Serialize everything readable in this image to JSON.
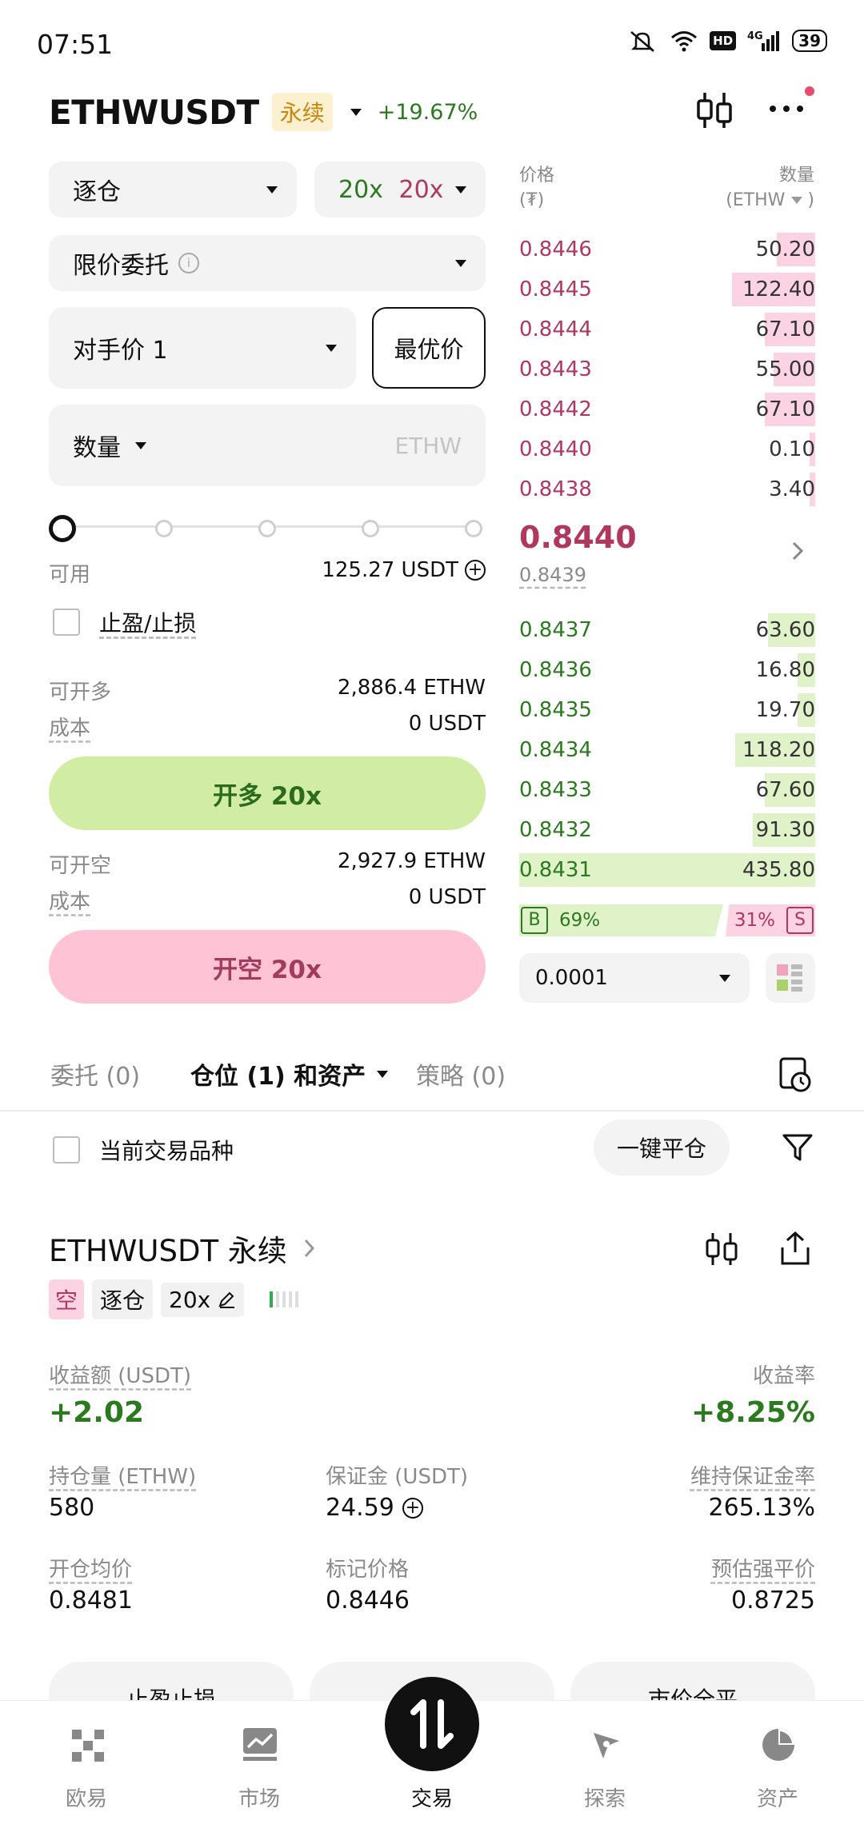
{
  "status_bar": {
    "time": "07:51",
    "battery": "39"
  },
  "header": {
    "symbol": "ETHWUSDT",
    "contract_tag": "永续",
    "change": "+19.67%"
  },
  "order_form": {
    "margin_mode": "逐仓",
    "leverage_long": "20x",
    "leverage_short": "20x",
    "order_type": "限价委托",
    "price_mode": "对手价 1",
    "best_price_button": "最优价",
    "quantity_label": "数量",
    "quantity_unit": "ETHW",
    "available_label": "可用",
    "available_value": "125.27 USDT",
    "tp_sl_label": "止盈/止损",
    "long_available_label": "可开多",
    "long_available_value": "2,886.4 ETHW",
    "long_cost_label": "成本",
    "long_cost_value": "0 USDT",
    "long_button": "开多 20x",
    "short_available_label": "可开空",
    "short_available_value": "2,927.9 ETHW",
    "short_cost_label": "成本",
    "short_cost_value": "0 USDT",
    "short_button": "开空 20x"
  },
  "order_book": {
    "price_header": "价格",
    "price_unit": "(₮)",
    "qty_header": "数量",
    "qty_unit": "(ETHW",
    "asks": [
      {
        "price": "0.8446",
        "qty": "50.20",
        "depth": 0.13
      },
      {
        "price": "0.8445",
        "qty": "122.40",
        "depth": 0.28
      },
      {
        "price": "0.8444",
        "qty": "67.10",
        "depth": 0.17
      },
      {
        "price": "0.8443",
        "qty": "55.00",
        "depth": 0.14
      },
      {
        "price": "0.8442",
        "qty": "67.10",
        "depth": 0.17
      },
      {
        "price": "0.8440",
        "qty": "0.10",
        "depth": 0.02
      },
      {
        "price": "0.8438",
        "qty": "3.40",
        "depth": 0.02
      }
    ],
    "last_price": "0.8440",
    "mark_price": "0.8439",
    "bids": [
      {
        "price": "0.8437",
        "qty": "63.60",
        "depth": 0.16
      },
      {
        "price": "0.8436",
        "qty": "16.80",
        "depth": 0.06
      },
      {
        "price": "0.8435",
        "qty": "19.70",
        "depth": 0.06
      },
      {
        "price": "0.8434",
        "qty": "118.20",
        "depth": 0.27
      },
      {
        "price": "0.8433",
        "qty": "67.60",
        "depth": 0.17
      },
      {
        "price": "0.8432",
        "qty": "91.30",
        "depth": 0.21
      },
      {
        "price": "0.8431",
        "qty": "435.80",
        "depth": 1.0
      }
    ],
    "buy_label": "B",
    "buy_pct": "69%",
    "sell_pct": "31%",
    "sell_label": "S",
    "tick_size": "0.0001"
  },
  "tabs": {
    "orders": "委托 (0)",
    "positions": "仓位 (1) 和资产",
    "strategies": "策略 (0)"
  },
  "filter_row": {
    "current_only": "当前交易品种",
    "close_all": "一键平仓"
  },
  "position": {
    "title": "ETHWUSDT 永续",
    "side": "空",
    "mode": "逐仓",
    "leverage": "20x",
    "pnl_label": "收益额 (USDT)",
    "pnl_value": "+2.02",
    "roe_label": "收益率",
    "roe_value": "+8.25%",
    "size_label": "持仓量 (ETHW)",
    "size_value": "580",
    "margin_label": "保证金 (USDT)",
    "margin_value": "24.59",
    "mmr_label": "维持保证金率",
    "mmr_value": "265.13%",
    "entry_label": "开仓均价",
    "entry_value": "0.8481",
    "mark_label": "标记价格",
    "mark_value": "0.8446",
    "liq_label": "预估强平价",
    "liq_value": "0.8725",
    "btn_tpsl": "止盈止损",
    "btn_close": "市价全平"
  },
  "bottom_nav": [
    {
      "label": "欧易",
      "icon": "okx-logo-icon"
    },
    {
      "label": "市场",
      "icon": "market-chart-icon"
    },
    {
      "label": "交易",
      "icon": "trade-swap-icon"
    },
    {
      "label": "探索",
      "icon": "explore-compass-icon"
    },
    {
      "label": "资产",
      "icon": "assets-pie-icon"
    }
  ],
  "colors": {
    "sell": "#b0385f",
    "buy": "#2c7a1f",
    "sell_bg": "#fbd3e2",
    "buy_bg": "#e0f2c8",
    "long_btn": "#d1eda4",
    "short_btn": "#fec4d6"
  }
}
